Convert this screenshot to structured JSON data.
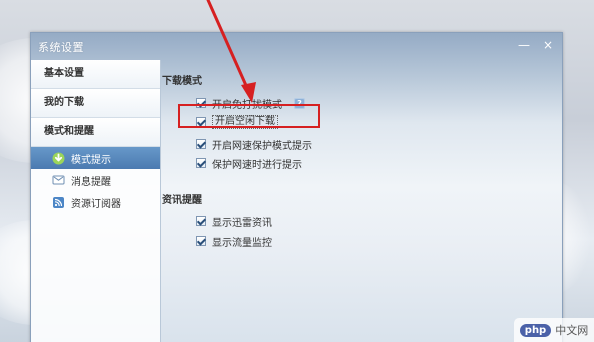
{
  "window": {
    "title": "系统设置",
    "controls": {
      "minimize": "—",
      "close": "×"
    }
  },
  "sidebar": {
    "sections": [
      {
        "label": "基本设置",
        "active": false
      },
      {
        "label": "我的下载",
        "active": false
      },
      {
        "label": "模式和提醒",
        "active": false
      }
    ],
    "subitems": [
      {
        "label": "模式提示",
        "icon": "download-arrow-icon",
        "active": true
      },
      {
        "label": "消息提醒",
        "icon": "message-icon",
        "active": false
      },
      {
        "label": "资源订阅器",
        "icon": "rss-icon",
        "active": false
      }
    ]
  },
  "main": {
    "download_mode": {
      "title": "下载模式",
      "options": [
        {
          "label": "开启免打扰模式",
          "checked": true,
          "help_icon": "help-icon",
          "help_text": "?"
        },
        {
          "label": "开启空闲下载",
          "checked": true,
          "focused": true
        },
        {
          "label": "开启网速保护模式提示",
          "checked": true
        },
        {
          "label": "保护网速时进行提示",
          "checked": true
        }
      ]
    },
    "news_reminder": {
      "title": "资讯提醒",
      "options": [
        {
          "label": "显示迅雷资讯",
          "checked": true
        },
        {
          "label": "显示流量监控",
          "checked": true
        }
      ]
    }
  },
  "annotation": {
    "highlight_color": "#d62021"
  },
  "watermark": {
    "logo": "php",
    "label": "中文网"
  }
}
